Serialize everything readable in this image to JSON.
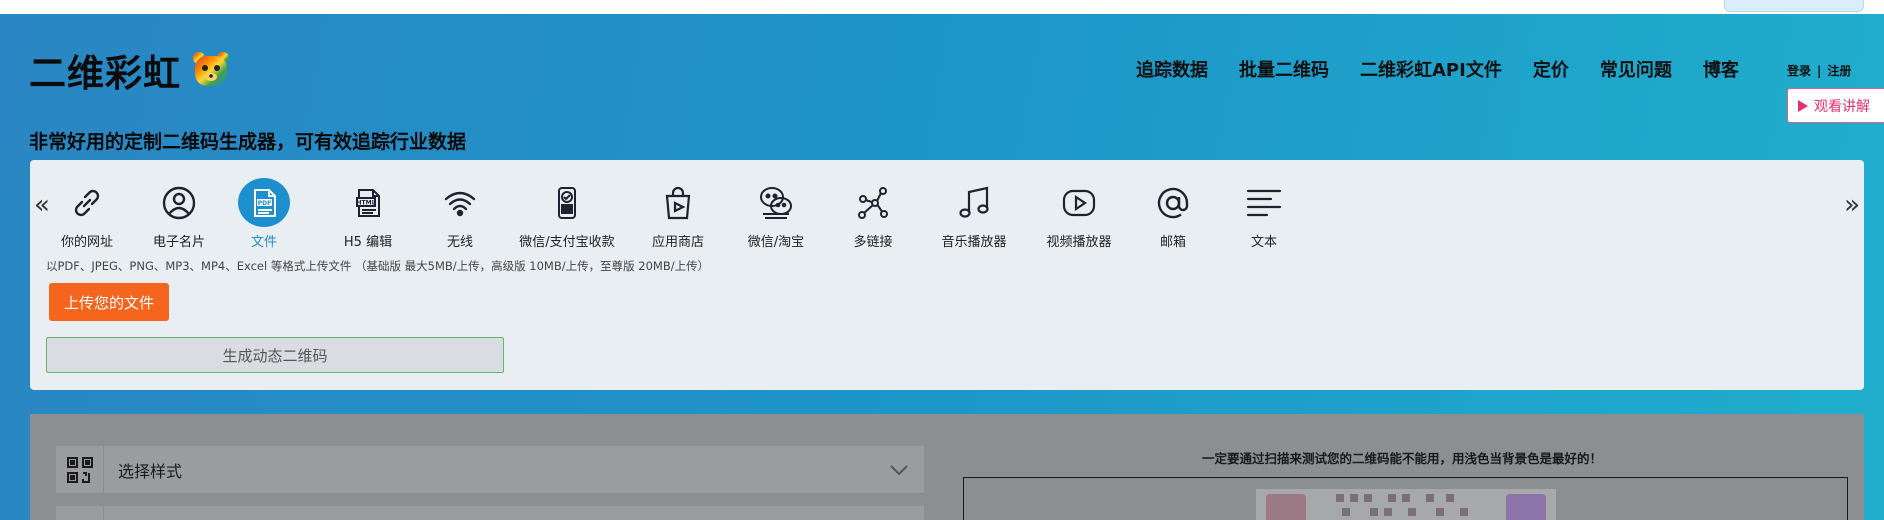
{
  "header": {
    "logo_text": "二维彩虹",
    "tagline": "非常好用的定制二维码生成器，可有效追踪行业数据",
    "nav": [
      "追踪数据",
      "批量二维码",
      "二维彩虹API文件",
      "定价",
      "常见问题",
      "博客"
    ],
    "login": "登录",
    "separator": "|",
    "register": "注册",
    "watch_button": "观看讲解"
  },
  "types": {
    "prev_arrow": "«",
    "next_arrow": "»",
    "items": [
      {
        "label": "你的网址",
        "icon": "link-icon"
      },
      {
        "label": "电子名片",
        "icon": "user-icon"
      },
      {
        "label": "文件",
        "icon": "pdf-file-icon",
        "active": true
      },
      {
        "label": "H5 编辑",
        "icon": "html-file-icon"
      },
      {
        "label": "无线",
        "icon": "wifi-icon"
      },
      {
        "label": "微信/支付宝收款",
        "icon": "payment-icon"
      },
      {
        "label": "应用商店",
        "icon": "shopping-bag-icon"
      },
      {
        "label": "微信/淘宝",
        "icon": "wechat-icon"
      },
      {
        "label": "多链接",
        "icon": "share-nodes-icon"
      },
      {
        "label": "音乐播放器",
        "icon": "music-note-icon"
      },
      {
        "label": "视频播放器",
        "icon": "video-play-icon"
      },
      {
        "label": "邮箱",
        "icon": "at-sign-icon"
      },
      {
        "label": "文本",
        "icon": "text-lines-icon"
      }
    ]
  },
  "upload": {
    "hint": "以PDF、JPEG、PNG、MP3、MP4、Excel 等格式上传文件  （基础版 最大5MB/上传，高级版 10MB/上传，至尊版 20MB/上传）",
    "upload_button": "上传您的文件",
    "generate_button": "生成动态二维码"
  },
  "settings": {
    "style_select_label": "选择样式",
    "notice": "一定要通过扫描来测试您的二维码能不能用，用浅色当背景色是最好的！"
  },
  "colors": {
    "accent_blue": "#1d8fcf",
    "upload_orange": "#f5651e",
    "watch_pink": "#e0336d"
  }
}
